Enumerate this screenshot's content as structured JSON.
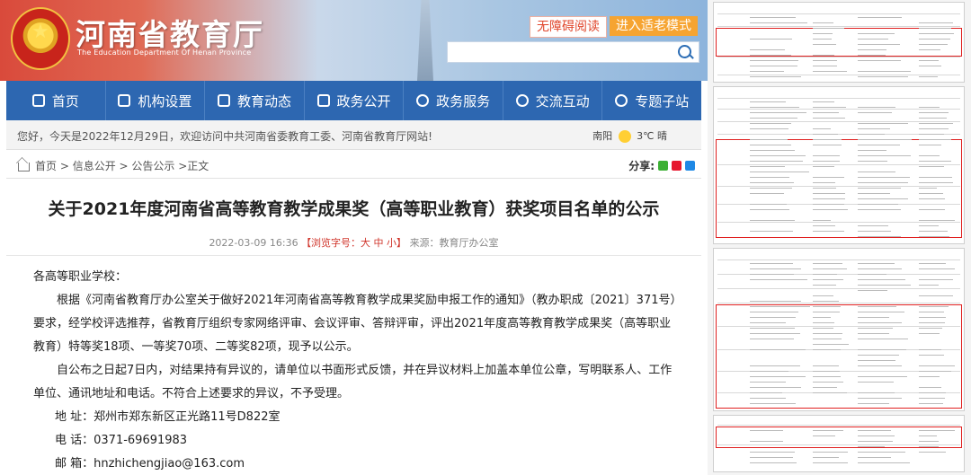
{
  "header": {
    "site_title": "河南省教育厅",
    "site_subtitle": "The Education Department Of Henan Province",
    "accessibility_label": "无障碍阅读",
    "elder_mode_label": "进入适老模式",
    "search_placeholder": ""
  },
  "nav": {
    "items": [
      {
        "label": "首页",
        "icon": "home-icon"
      },
      {
        "label": "机构设置",
        "icon": "org-icon"
      },
      {
        "label": "教育动态",
        "icon": "news-icon"
      },
      {
        "label": "政务公开",
        "icon": "gov-icon"
      },
      {
        "label": "政务服务",
        "icon": "service-icon"
      },
      {
        "label": "交流互动",
        "icon": "chat-icon"
      },
      {
        "label": "专题子站",
        "icon": "topic-icon"
      }
    ]
  },
  "notice": {
    "text": "您好，今天是2022年12月29日，欢迎访问中共河南省委教育工委、河南省教育厅网站!",
    "city": "南阳",
    "weather": "3℃ 晴"
  },
  "breadcrumb": {
    "home": "首页",
    "sep1": " > ",
    "level1": "信息公开",
    "sep2": " > ",
    "level2": "公告公示",
    "sep3": " >",
    "current": "正文"
  },
  "share": {
    "label": "分享:"
  },
  "article": {
    "title": "关于2021年度河南省高等教育教学成果奖（高等职业教育）获奖项目名单的公示",
    "date": "2022-03-09 16:36",
    "font_size_label": "【浏览字号：大 中 小】",
    "source": "来源：教育厅办公室",
    "salutation": "各高等职业学校：",
    "para1": "根据《河南省教育厅办公室关于做好2021年河南省高等教育教学成果奖励申报工作的通知》（教办职成〔2021〕371号）要求，经学校评选推荐，省教育厅组织专家网络评审、会议评审、答辩评审，评出2021年度高等教育教学成果奖（高等职业教育）特等奖18项、一等奖70项、二等奖82项，现予以公示。",
    "para2": "自公布之日起7日内，对结果持有异议的，请单位以书面形式反馈，并在异议材料上加盖本单位公章，写明联系人、工作单位、通讯地址和电话。不符合上述要求的异议，不予受理。",
    "address": "地 址：郑州市郑东新区正光路11号D822室",
    "phone": "电 话：0371-69691983",
    "email": "邮 箱：hnzhichengjiao@163.com"
  },
  "colors": {
    "nav_blue": "#2d67b1",
    "accent_orange": "#f6a431",
    "highlight_red": "#e02020"
  }
}
